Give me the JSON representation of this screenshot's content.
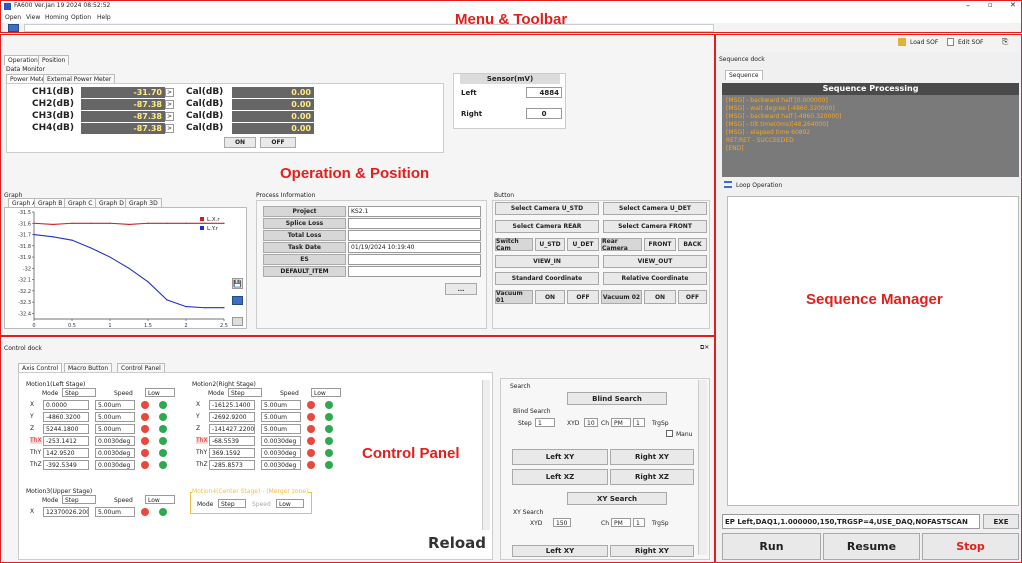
{
  "app": {
    "title": "FA600 Ver.Jan 19 2024 08:52:52",
    "menu": [
      "Open",
      "View",
      "Homing",
      "Option",
      "Help"
    ],
    "toolbar_right": [
      "Load SOF",
      "Edit SOF"
    ]
  },
  "annotations": {
    "menu_toolbar": "Menu & Toolbar",
    "operation": "Operation & Position",
    "sequence": "Sequence Manager",
    "control": "Control Panel"
  },
  "operation": {
    "tabs": [
      "Operation",
      "Position"
    ],
    "group": "Data Monitor",
    "subtabs": [
      "Power Meter",
      "External Power Meter"
    ],
    "channels": [
      {
        "label": "CH1(dB)",
        "value": "-31.70",
        "cal_label": "Cal(dB)",
        "cal": "0.00"
      },
      {
        "label": "CH2(dB)",
        "value": "-87.38",
        "cal_label": "Cal(dB)",
        "cal": "0.00"
      },
      {
        "label": "CH3(dB)",
        "value": "-87.38",
        "cal_label": "Cal(dB)",
        "cal": "0.00"
      },
      {
        "label": "CH4(dB)",
        "value": "-87.38",
        "cal_label": "Cal(dB)",
        "cal": "0.00"
      }
    ],
    "on": "ON",
    "off": "OFF",
    "sensor": {
      "title": "Sensor(mV)",
      "left_label": "Left",
      "left": "4884",
      "right_label": "Right",
      "right": "0"
    }
  },
  "graph": {
    "title": "Graph",
    "tabs": [
      "Graph A",
      "Graph B",
      "Graph C",
      "Graph D",
      "Graph 3D"
    ],
    "legend": [
      "L.X.r",
      "L.Y.r"
    ],
    "y_ticks": [
      "-31.5",
      "-31.6",
      "-31.7",
      "-31.8",
      "-31.9",
      "-32",
      "-32.1",
      "-32.2",
      "-32.3",
      "-32.4"
    ],
    "x_ticks": [
      "0",
      "0.5",
      "1",
      "1.5",
      "2",
      "2.5"
    ]
  },
  "process": {
    "title": "Process Information",
    "rows": [
      {
        "k": "Project",
        "v": "KS2.1"
      },
      {
        "k": "Splice Loss",
        "v": ""
      },
      {
        "k": "Total Loss",
        "v": ""
      },
      {
        "k": "Task Date",
        "v": "01/19/2024 10:19:40"
      },
      {
        "k": "ES",
        "v": ""
      },
      {
        "k": "DEFAULT_ITEM",
        "v": ""
      }
    ],
    "more": "..."
  },
  "buttons": {
    "title": "Button",
    "cam_u_std": "Select Camera U_STD",
    "cam_u_det": "Select Camera U_DET",
    "cam_rear": "Select Camera REAR",
    "cam_front": "Select Camera FRONT",
    "switch": "Switch Cam",
    "u_std": "U_STD",
    "u_det": "U_DET",
    "rear": "Rear Camera",
    "front": "FRONT",
    "back": "BACK",
    "view_in": "VIEW_IN",
    "view_out": "VIEW_OUT",
    "std_coord": "Standard Coordinate",
    "rel_coord": "Relative Coordinate",
    "vac1": "Vacuum 01",
    "vac2": "Vacuum 02",
    "on": "ON",
    "off": "OFF"
  },
  "seq": {
    "dock": "Sequence dock",
    "tab": "Sequence",
    "title": "Sequence Processing",
    "log": [
      "[MSG] - backward half [0.000000]",
      "[MSG] - wait degree [-4860.320000]",
      "[MSG] - backward half [-4860.320000]",
      "[MSG] - tilt time(0ms)[48.264000]",
      "[MSG] - elapsed time 60892",
      "RET:RET - SUCCEEDED",
      "[END]"
    ],
    "loop": "Loop Operation",
    "cmd": "EP Left,DAQ1,1.000000,150,TRGSP=4,USE_DAQ,NOFASTSCAN",
    "exe": "EXE",
    "run": "Run",
    "resume": "Resume",
    "stop": "Stop"
  },
  "control": {
    "dock": "Control dock",
    "tabs": [
      "Axis Control",
      "Macro Button",
      "Control Panel"
    ],
    "m1": {
      "title": "Motion1(Left Stage)",
      "mode": "Mode",
      "mode_v": "Step",
      "speed": "Speed",
      "speed_v": "Low",
      "axes": [
        {
          "n": "X",
          "v": "0.0000",
          "s": "5.00um"
        },
        {
          "n": "Y",
          "v": "-4860.3200",
          "s": "5.00um"
        },
        {
          "n": "Z",
          "v": "5244.1800",
          "s": "5.00um"
        },
        {
          "n": "ThX",
          "v": "-253.1412",
          "s": "0.0030deg"
        },
        {
          "n": "ThY",
          "v": "142.9520",
          "s": "0.0030deg"
        },
        {
          "n": "ThZ",
          "v": "-392.5349",
          "s": "0.0030deg"
        }
      ]
    },
    "m2": {
      "title": "Motion2(Right Stage)",
      "mode": "Mode",
      "mode_v": "Step",
      "speed": "Speed",
      "speed_v": "Low",
      "axes": [
        {
          "n": "X",
          "v": "-16125.1400",
          "s": "5.00um"
        },
        {
          "n": "Y",
          "v": "-2692.9200",
          "s": "5.00um"
        },
        {
          "n": "Z",
          "v": "-141427.2200",
          "s": "5.00um"
        },
        {
          "n": "ThX",
          "v": "-68.5539",
          "s": "0.0030deg"
        },
        {
          "n": "ThY",
          "v": "369.1592",
          "s": "0.0030deg"
        },
        {
          "n": "ThZ",
          "v": "-285.8573",
          "s": "0.0030deg"
        }
      ]
    },
    "m3": {
      "title": "Motion3(Upper Stage)",
      "mode": "Mode",
      "mode_v": "Step",
      "speed": "Speed",
      "speed_v": "Low",
      "x": "X",
      "xv": "12370026.2000",
      "xs": "5.00um"
    },
    "m4": {
      "title": "Motion4(Center Stage) - (Merger zone)",
      "mode": "Mode",
      "mode_v": "Step",
      "speed": "Speed",
      "speed_v": "Low"
    },
    "reload": "Reload",
    "search": {
      "title": "Search",
      "blind": "Blind Search",
      "bs_group": "Blind Search",
      "step": "Step",
      "step_v": "1",
      "xyd": "XYD",
      "xyd_v": "10",
      "ch": "Ch",
      "ch_v": "PM",
      "ch_n": "1",
      "trgsp": "TrgSp",
      "manual": "Manu",
      "left_xy": "Left XY",
      "right_xy": "Right XY",
      "left_xz": "Left XZ",
      "right_xz": "Right XZ",
      "xy_search": "XY Search",
      "xy_group": "XY Search",
      "xyd2": "XYD",
      "xyd2_v": "150",
      "left_xy2": "Left XY",
      "right_xy2": "Right XY"
    }
  },
  "chart_data": {
    "type": "line",
    "title": "",
    "xlabel": "",
    "ylabel": "",
    "xlim": [
      0,
      2.5
    ],
    "ylim": [
      -32.45,
      -31.5
    ],
    "legend_position": "top-right",
    "series": [
      {
        "name": "L.X.r",
        "color": "#cc2020",
        "x": [
          0,
          0.25,
          0.5,
          0.75,
          1,
          1.25,
          1.5,
          1.75,
          2,
          2.25,
          2.5
        ],
        "y": [
          -31.6,
          -31.61,
          -31.6,
          -31.6,
          -31.6,
          -31.61,
          -31.6,
          -31.6,
          -31.6,
          -31.6,
          -31.6
        ]
      },
      {
        "name": "L.Y.r",
        "color": "#2030cc",
        "x": [
          0,
          0.25,
          0.5,
          0.75,
          1,
          1.25,
          1.5,
          1.75,
          2,
          2.25,
          2.5
        ],
        "y": [
          -31.7,
          -31.72,
          -31.75,
          -31.82,
          -31.9,
          -32.0,
          -32.12,
          -32.28,
          -32.34,
          -32.35,
          -32.35
        ]
      }
    ]
  }
}
